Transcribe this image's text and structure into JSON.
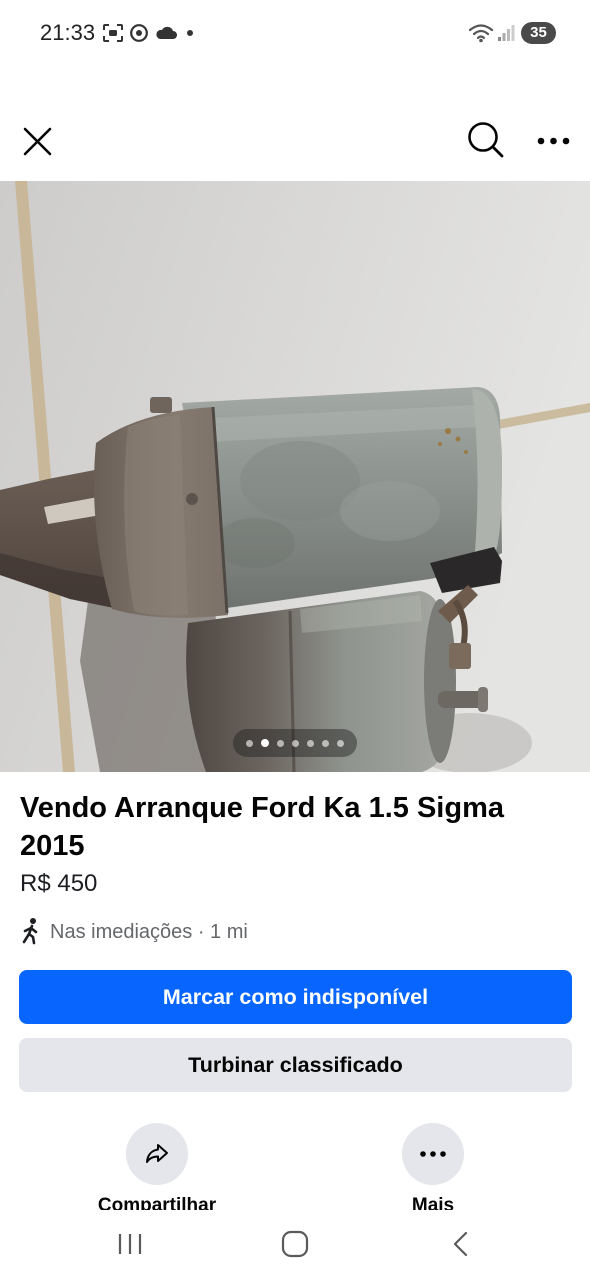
{
  "status_bar": {
    "time": "21:33",
    "battery_level": "35",
    "left_icons": [
      "screenshot-icon",
      "chrome-icon",
      "cloud-icon",
      "notification-dot-icon"
    ],
    "right_icons": [
      "wifi-icon",
      "signal-icon",
      "battery-icon"
    ]
  },
  "header": {
    "icons": {
      "close": "close-icon",
      "search": "search-icon",
      "more": "more-options-icon"
    }
  },
  "gallery": {
    "page_count": 7,
    "current_page": 2
  },
  "listing": {
    "title": "Vendo Arranque Ford Ka 1.5 Sigma 2015",
    "price": "R$ 450",
    "location": "Nas imediações · 1 mi",
    "location_icon": "walking-person-icon"
  },
  "buttons": {
    "mark_unavailable": "Marcar como indisponível",
    "boost_listing": "Turbinar classificado"
  },
  "actions": [
    {
      "label": "Compartilhar",
      "icon": "share-icon"
    },
    {
      "label": "Mais",
      "icon": "more-icon"
    }
  ],
  "nav_bar": {
    "icons": [
      "recent-apps-icon",
      "home-icon",
      "back-icon"
    ]
  },
  "colors": {
    "primary_button": "#0866FF",
    "secondary_button": "#E4E6EB",
    "text_primary": "#050505",
    "text_secondary": "#65676B"
  }
}
